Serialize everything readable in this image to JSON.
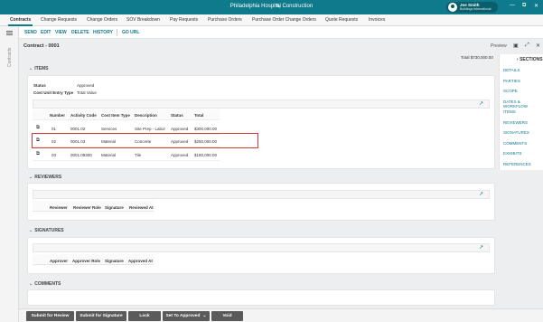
{
  "app": {
    "title": "Philadelphia Hospital Construction",
    "user_name": "Joe Smith",
    "user_org": "Buildings International",
    "pencil_icon": "✎",
    "minimize_icon": "—",
    "restore_icon": "⧉",
    "close_icon": "✕"
  },
  "tabs": [
    {
      "label": "Contracts",
      "active": true
    },
    {
      "label": "Change Requests"
    },
    {
      "label": "Change Orders"
    },
    {
      "label": "SOV Breakdown"
    },
    {
      "label": "Pay Requests"
    },
    {
      "label": "Purchase Orders"
    },
    {
      "label": "Purchase Order Change Orders"
    },
    {
      "label": "Quote Requests"
    },
    {
      "label": "Invoices"
    }
  ],
  "left_rail": {
    "label": "Contracts"
  },
  "actions": [
    "SEND",
    "EDIT",
    "VIEW",
    "DELETE",
    "HISTORY",
    "GO URL"
  ],
  "contract": {
    "title": "Contract - 0001",
    "preview_label": "Preview",
    "total": "Total $730,000.00"
  },
  "items_section": {
    "title": "ITEMS",
    "status_label": "Status",
    "status_value": "Approved",
    "entry_type_label": "Cost Unit Entry Type",
    "entry_type_value": "Total Value",
    "columns": [
      "Number",
      "Activity Code",
      "Cost Item Type",
      "Description",
      "Status",
      "Total"
    ],
    "rows": [
      [
        "01",
        "0001.02",
        "Services",
        "Site Prep - Labor",
        "Approved",
        "$300,000.00"
      ],
      [
        "02",
        "0001.03",
        "Material",
        "Concrete",
        "Approved",
        "$250,000.00"
      ],
      [
        "03",
        "0001.09300",
        "Material",
        "Tile",
        "Approved",
        "$180,000.00"
      ]
    ]
  },
  "reviewers_section": {
    "title": "REVIEWERS",
    "columns": [
      "Reviewer",
      "Reviewer Role",
      "Signature",
      "Reviewed At"
    ]
  },
  "signatures_section": {
    "title": "SIGNATURES",
    "columns": [
      "Approver",
      "Approver Role",
      "Signature",
      "Approved At"
    ]
  },
  "comments_section": {
    "title": "COMMENTS"
  },
  "sections_panel": {
    "title": "SECTIONS",
    "items": [
      "DETAILS",
      "PARTIES",
      "SCOPE",
      "DATES & WORKFLOW",
      "ITEMS",
      "REVIEWERS",
      "SIGNATURES",
      "COMMENTS",
      "EXHIBITS",
      "REFERENCES"
    ]
  },
  "footer": {
    "buttons": [
      "Submit for Review",
      "Submit for Signature",
      "Lock",
      "Set To Approved",
      "Void"
    ]
  },
  "colors": {
    "accent": "#0f7a8c",
    "highlight": "#d23a3a",
    "button": "#5a5a5a"
  }
}
